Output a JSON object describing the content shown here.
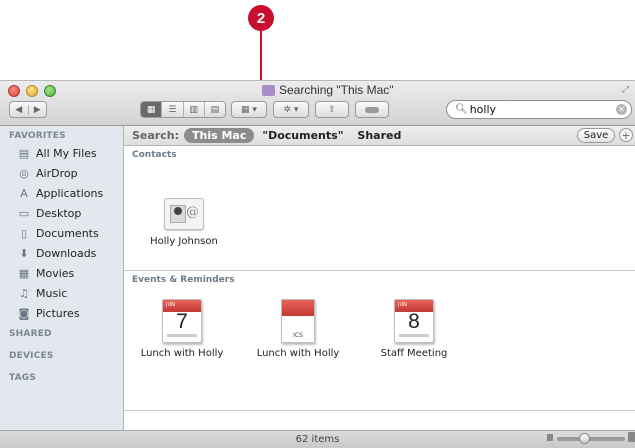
{
  "callout": {
    "number": "2"
  },
  "window": {
    "title": "Searching \"This Mac\""
  },
  "search": {
    "value": "holly",
    "placeholder": "Search"
  },
  "sidebar": {
    "favorites_heading": "FAVORITES",
    "items": [
      {
        "label": "All My Files",
        "icon": "all-files-icon"
      },
      {
        "label": "AirDrop",
        "icon": "airdrop-icon"
      },
      {
        "label": "Applications",
        "icon": "applications-icon"
      },
      {
        "label": "Desktop",
        "icon": "desktop-icon"
      },
      {
        "label": "Documents",
        "icon": "documents-icon"
      },
      {
        "label": "Downloads",
        "icon": "downloads-icon"
      },
      {
        "label": "Movies",
        "icon": "movies-icon"
      },
      {
        "label": "Music",
        "icon": "music-icon"
      },
      {
        "label": "Pictures",
        "icon": "pictures-icon"
      }
    ],
    "shared_heading": "SHARED",
    "devices_heading": "DEVICES",
    "tags_heading": "TAGS"
  },
  "scope": {
    "label": "Search:",
    "this_mac": "This Mac",
    "documents": "\"Documents\"",
    "shared": "Shared",
    "save": "Save",
    "add": "+"
  },
  "sections": {
    "contacts": "Contacts",
    "events": "Events & Reminders"
  },
  "contacts": [
    {
      "name": "Holly Johnson"
    }
  ],
  "events": [
    {
      "name": "Lunch with Holly",
      "kind": "calendar",
      "month": "JUN",
      "day": "7"
    },
    {
      "name": "Lunch with Holly",
      "kind": "ics",
      "ext": "ICS"
    },
    {
      "name": "Staff Meeting",
      "kind": "calendar",
      "month": "JUN",
      "day": "8"
    }
  ],
  "status": {
    "items": "62 items"
  }
}
